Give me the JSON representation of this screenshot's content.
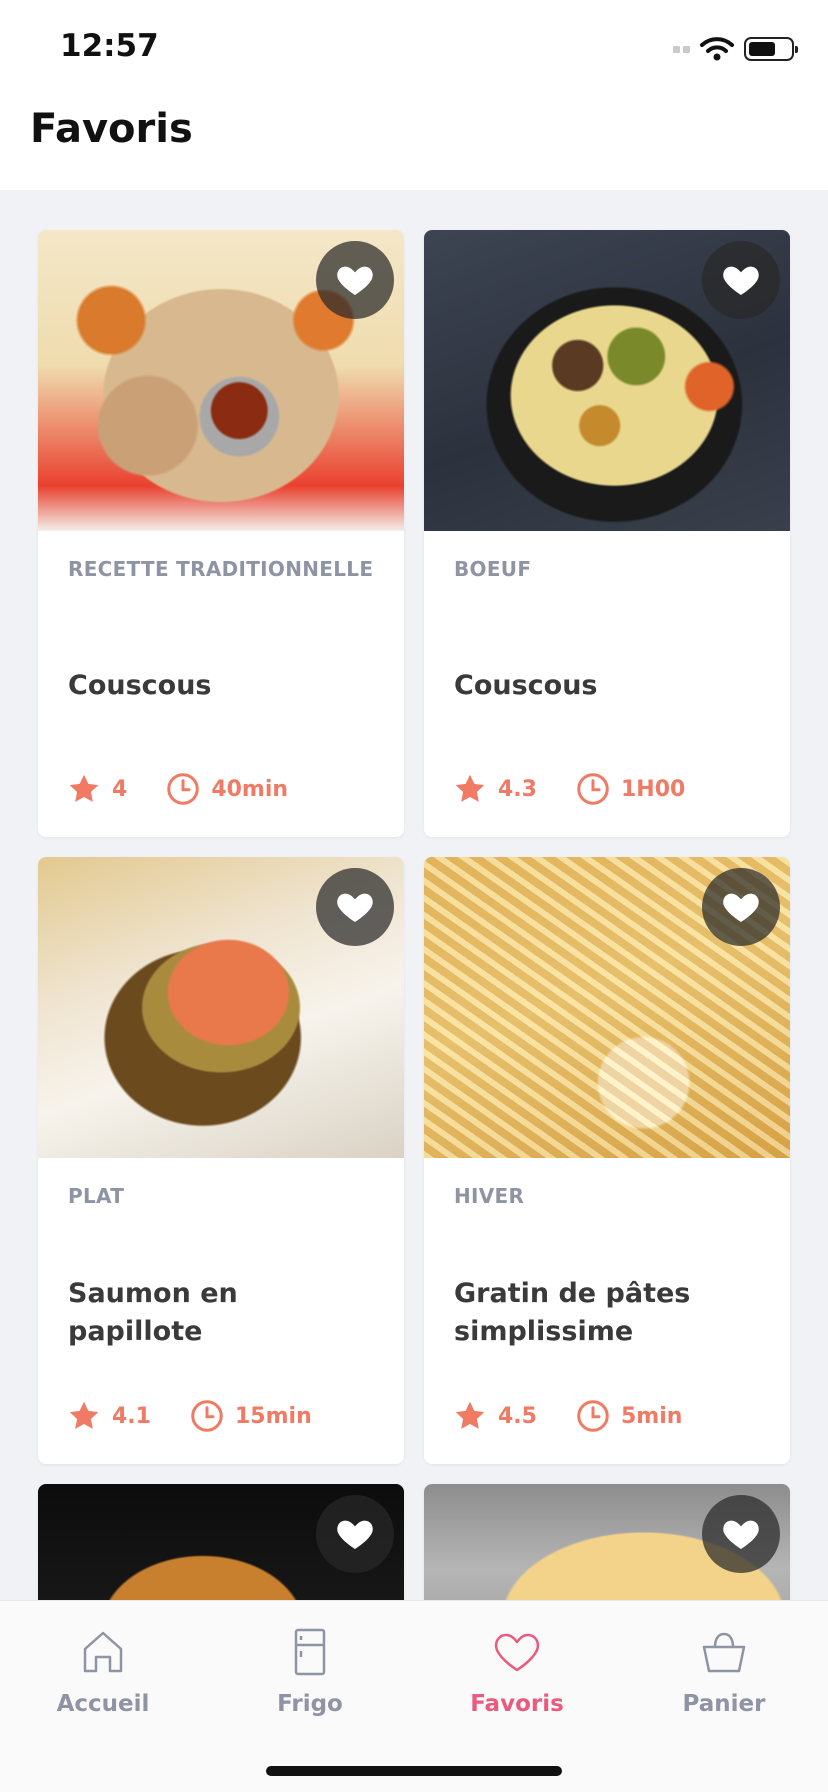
{
  "status_bar": {
    "time": "12:57"
  },
  "header": {
    "title": "Favoris"
  },
  "colors": {
    "accent": "#f07a63",
    "active_tab": "#ea5a7c",
    "muted": "#8e94a3"
  },
  "recipes": [
    {
      "category": "RECETTE TRADITIONNELLE",
      "title": "Couscous",
      "rating": "4",
      "duration": "40min"
    },
    {
      "category": "BOEUF",
      "title": "Couscous",
      "rating": "4.3",
      "duration": "1H00"
    },
    {
      "category": "PLAT",
      "title": "Saumon en papillote",
      "rating": "4.1",
      "duration": "15min"
    },
    {
      "category": "HIVER",
      "title": "Gratin de pâtes simplissime",
      "rating": "4.5",
      "duration": "5min"
    }
  ],
  "tabs": [
    {
      "label": "Accueil",
      "icon": "home-icon",
      "active": false
    },
    {
      "label": "Frigo",
      "icon": "fridge-icon",
      "active": false
    },
    {
      "label": "Favoris",
      "icon": "heart-icon",
      "active": true
    },
    {
      "label": "Panier",
      "icon": "basket-icon",
      "active": false
    }
  ]
}
